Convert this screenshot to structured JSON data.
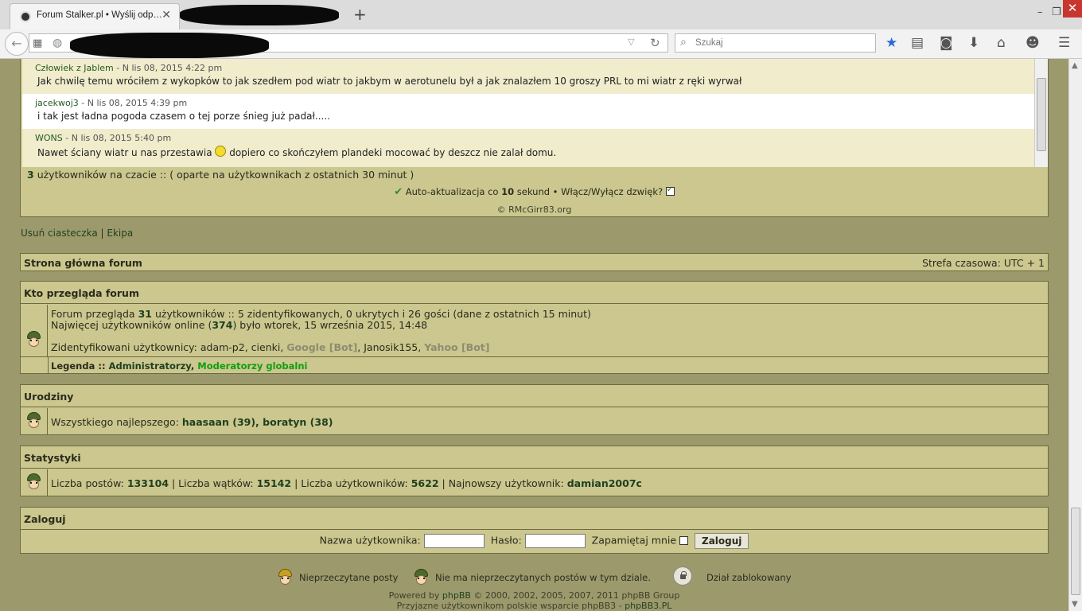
{
  "browser": {
    "tab_title": "Forum Stalker.pl • Wyślij odp…",
    "tab_close": "✕",
    "new_tab": "+",
    "search_placeholder": "Szukaj",
    "win_minimize": "–",
    "win_restore": "❐",
    "win_close": "✕"
  },
  "chat": {
    "messages": [
      {
        "user": "Człowiek z Jablem",
        "time": "- N lis 08, 2015 4:22 pm",
        "text": "Jak chwilę temu wróciłem z wykopków to jak szedłem pod wiatr to jakbym w aerotunelu był a jak znalazłem 10 groszy PRL to mi wiatr z ręki wyrwał"
      },
      {
        "user": "jacekwoj3",
        "time": "- N lis 08, 2015 4:39 pm",
        "text": "i tak jest ładna pogoda czasem o tej porze śnieg już padał....."
      },
      {
        "user": "WONS",
        "time": "- N lis 08, 2015 5:40 pm",
        "text_before": "Nawet ściany wiatr u nas przestawia",
        "text_after": "dopiero co skończyłem plandeki mocować by deszcz nie zalał domu."
      }
    ],
    "online_count": "3",
    "online_text": "użytkowników na czacie ::  ( oparte na użytkownikach z ostatnich 30 minut )",
    "autoupdate_pre": "Auto-aktualizacja co",
    "autoupdate_num": "10",
    "autoupdate_post": "sekund • Włącz/Wyłącz dzwięk?",
    "copyright": "© RMcGirr83.org"
  },
  "links": {
    "delete_cookies": "Usuń ciasteczka",
    "sep": "|",
    "team": "Ekipa"
  },
  "navbar": {
    "home": "Strona główna forum",
    "timezone": "Strefa czasowa: UTC + 1"
  },
  "who": {
    "title": "Kto przegląda forum",
    "line1_pre": "Forum przegląda",
    "line1_num": "31",
    "line1_post": "użytkowników :: 5 zidentyfikowanych, 0 ukrytych i 26 gości (dane z ostatnich 15 minut)",
    "line2_pre": "Najwięcej użytkowników online (",
    "line2_num": "374",
    "line2_post": ") było wtorek, 15 września 2015, 14:48",
    "identified_label": "Zidentyfikowani użytkownicy:",
    "users": [
      "adam-p2",
      "cienki",
      "Google [Bot]",
      "Janosik155",
      "Yahoo [Bot]"
    ],
    "legend_label": "Legenda ::",
    "legend_admin": "Administratorzy",
    "legend_gmod": "Moderatorzy globalni"
  },
  "birthdays": {
    "title": "Urodziny",
    "text": "Wszystkiego najlepszego:",
    "users": "haasaan (39), boratyn (38)"
  },
  "stats": {
    "title": "Statystyki",
    "posts_label": "Liczba postów:",
    "posts": "133104",
    "topics_label": "| Liczba wątków:",
    "topics": "15142",
    "users_label": "| Liczba użytkowników:",
    "users": "5622",
    "newest_label": "| Najnowszy użytkownik:",
    "newest": "damian2007c"
  },
  "login": {
    "title": "Zaloguj",
    "username_label": "Nazwa użytkownika:",
    "password_label": "Hasło:",
    "remember_label": "Zapamiętaj mnie",
    "button": "Zaloguj"
  },
  "legend_icons": {
    "unread": "Nieprzeczytane posty",
    "no_unread": "Nie ma nieprzeczytanych postów w tym dziale.",
    "locked": "Dział zablokowany"
  },
  "powered": {
    "pre": "Powered by",
    "phpbb": "phpBB",
    "post": "© 2000, 2002, 2005, 2007, 2011 phpBB Group",
    "line2": "Przyjazne użytkownikom polskie wsparcie phpBB3 -",
    "phpbb3pl": "phpBB3.PL"
  }
}
